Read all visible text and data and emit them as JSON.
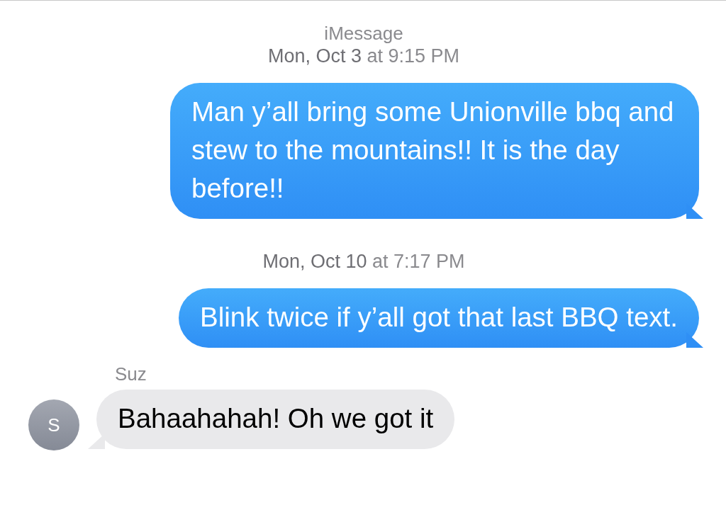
{
  "header": {
    "service": "iMessage"
  },
  "messages": [
    {
      "kind": "timestamp",
      "text": "**Mon, Oct 3** at 9:15 PM"
    },
    {
      "kind": "sent",
      "text": "Man y’all bring some Unionville bbq and stew to the mountains!! It is the day before!!"
    },
    {
      "kind": "timestamp",
      "text": "**Mon, Oct 10** at 7:17 PM"
    },
    {
      "kind": "sent",
      "text": "Blink twice if y’all got that last BBQ text."
    },
    {
      "kind": "received",
      "sender": "Suz",
      "avatar": "S",
      "text": "Bahaahahah! Oh we got it"
    }
  ]
}
